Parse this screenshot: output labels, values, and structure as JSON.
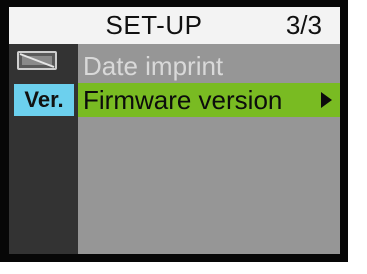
{
  "header": {
    "title": "SET-UP",
    "page_indicator": "3/3"
  },
  "side_icons": {
    "date_imprint_icon": "date-imprint-disabled-icon",
    "firmware_badge": "Ver."
  },
  "menu": {
    "items": [
      {
        "label": "Date imprint",
        "state": "disabled"
      },
      {
        "label": "Firmware version",
        "state": "selected",
        "has_submenu": true
      }
    ]
  },
  "colors": {
    "screen_bg": "#070707",
    "header_bg": "#f3f3f3",
    "side_bg": "#333333",
    "content_bg": "#969696",
    "selection_bg": "#79bb22",
    "badge_bg": "#6cd0ee"
  }
}
